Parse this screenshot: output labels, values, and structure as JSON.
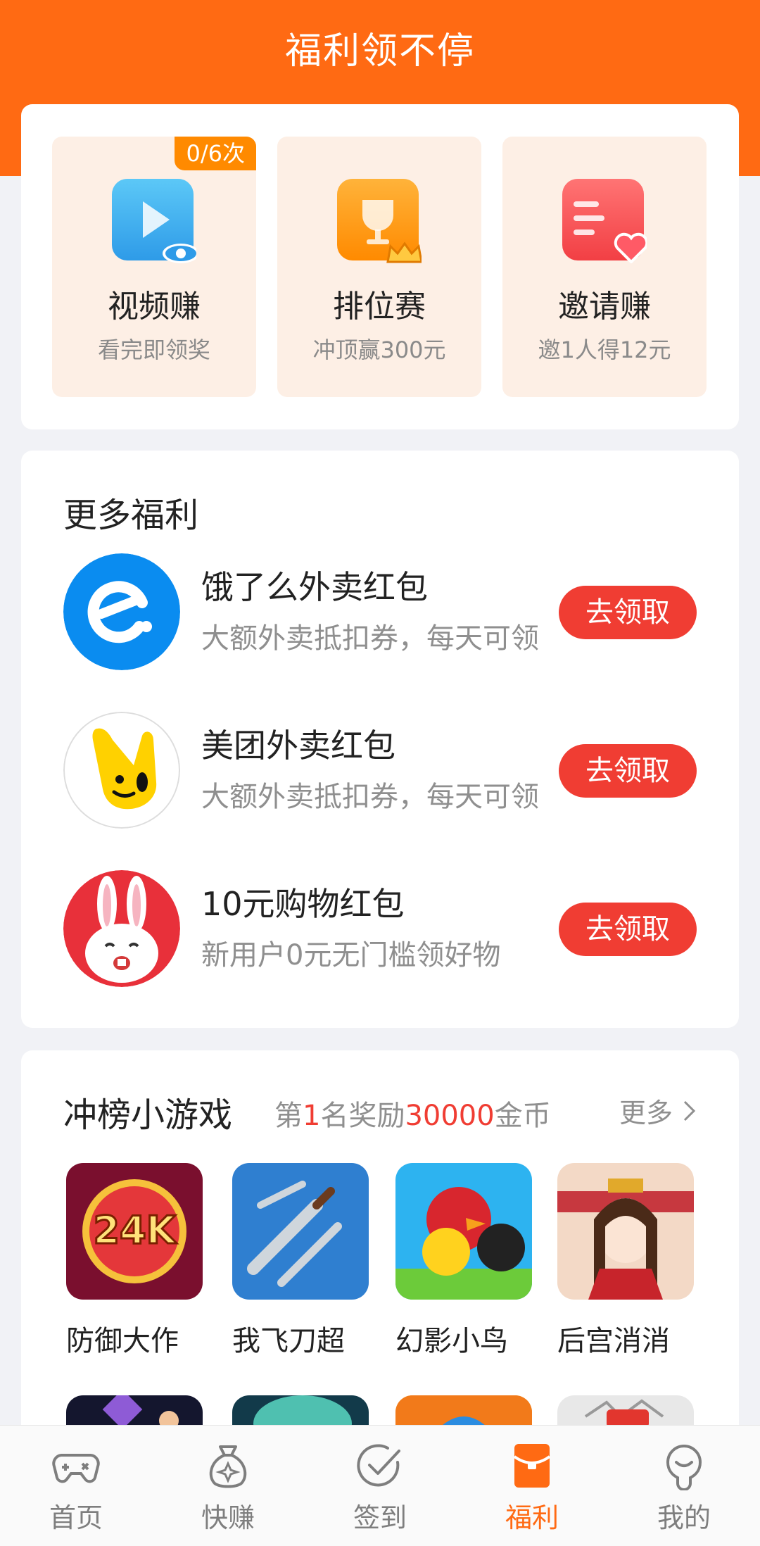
{
  "header": {
    "title": "福利领不停"
  },
  "tasks": [
    {
      "title": "视频赚",
      "subtitle": "看完即领奖",
      "badge": "0/6次",
      "icon": "video-play-icon"
    },
    {
      "title": "排位赛",
      "subtitle": "冲顶赢300元",
      "icon": "trophy-icon"
    },
    {
      "title": "邀请赚",
      "subtitle": "邀1人得12元",
      "icon": "invite-list-icon"
    }
  ],
  "more": {
    "title": "更多福利",
    "items": [
      {
        "name": "饿了么外卖红包",
        "desc": "大额外卖抵扣券，每天可领",
        "button": "去领取",
        "icon": "eleme-logo"
      },
      {
        "name": "美团外卖红包",
        "desc": "大额外卖抵扣券，每天可领",
        "button": "去领取",
        "icon": "meituan-logo"
      },
      {
        "name": "10元购物红包",
        "desc": "新用户0元无门槛领好物",
        "button": "去领取",
        "icon": "rabbit-logo"
      }
    ]
  },
  "games": {
    "title": "冲榜小游戏",
    "subtitle_prefix": "第",
    "subtitle_rank": "1",
    "subtitle_mid": "名奖励",
    "subtitle_amount": "30000",
    "subtitle_suffix": "金币",
    "more_label": "更多",
    "items": [
      {
        "name": "防御大作"
      },
      {
        "name": "我飞刀超"
      },
      {
        "name": "幻影小鸟"
      },
      {
        "name": "后宫消消"
      }
    ]
  },
  "nav": [
    {
      "label": "首页",
      "icon": "gamepad-icon",
      "active": false
    },
    {
      "label": "快赚",
      "icon": "money-bag-icon",
      "active": false
    },
    {
      "label": "签到",
      "icon": "check-circle-icon",
      "active": false
    },
    {
      "label": "福利",
      "icon": "red-envelope-icon",
      "active": true
    },
    {
      "label": "我的",
      "icon": "profile-icon",
      "active": false
    }
  ],
  "colors": {
    "brand": "#FF6A13",
    "button_red": "#F03D33",
    "badge_orange": "#FF8A00"
  }
}
